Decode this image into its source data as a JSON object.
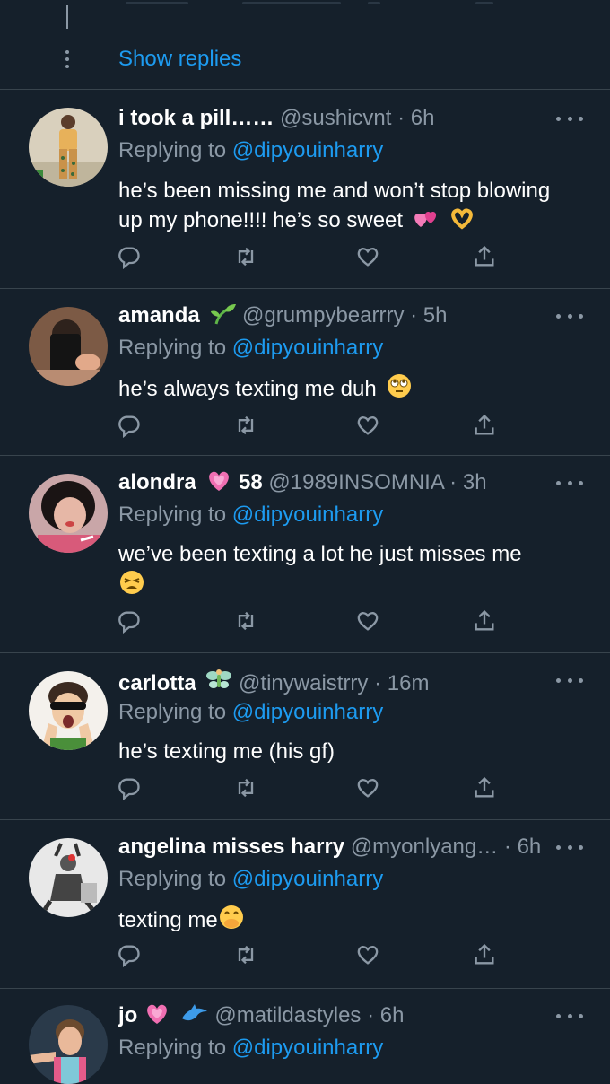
{
  "thread": {
    "show_replies": "Show replies"
  },
  "tweets": [
    {
      "name": "i took a pill…… ",
      "handle": "@sushicvnt · 6h",
      "replying_prefix": "Replying to ",
      "replying_to": "@dipyouinharry",
      "text_lines": [
        "he’s been missing me and won’t stop blowing",
        "up my phone!!!! he’s so sweet"
      ],
      "emojis": [
        "two-hearts",
        "heart-hands"
      ]
    },
    {
      "name": "amanda",
      "handle": "@grumpybearrry · 5h",
      "name_emoji": "seedling",
      "replying_prefix": "Replying to ",
      "replying_to": "@dipyouinharry",
      "text_lines": [
        "he’s always texting me duh"
      ],
      "emojis": [
        "rolling-eyes"
      ]
    },
    {
      "name": "alondra",
      "name_suffix": "58",
      "name_emoji": "growing-heart",
      "handle": "@1989INSOMNIA · 3h",
      "replying_prefix": "Replying to ",
      "replying_to": "@dipyouinharry",
      "text_lines": [
        "we’ve been texting a lot he just misses me"
      ],
      "emojis": [
        "tired-face"
      ]
    },
    {
      "name": "carlotta",
      "name_emoji": "fairy",
      "handle": "@tinywaistrry · 16m",
      "replying_prefix": "Replying to ",
      "replying_to": "@dipyouinharry",
      "text_lines": [
        "he’s texting me (his gf)"
      ]
    },
    {
      "name": "angelina misses harry",
      "handle": "@myonlyang… · 6h",
      "replying_prefix": "Replying to ",
      "replying_to": "@dipyouinharry",
      "text_lines": [
        "texting me"
      ],
      "emojis": [
        "hand-over-mouth"
      ]
    },
    {
      "name": "jo",
      "name_emoji": "heart-dolphin",
      "handle": "@matildastyles · 6h",
      "replying_prefix": "Replying to ",
      "replying_to": "@dipyouinharry"
    }
  ],
  "colors": {
    "background": "#15202b",
    "accent": "#1d9bf0",
    "muted": "#8b98a5",
    "divider": "#38444d"
  },
  "icons": [
    "reply-icon",
    "retweet-icon",
    "like-icon",
    "share-icon",
    "more-icon"
  ]
}
